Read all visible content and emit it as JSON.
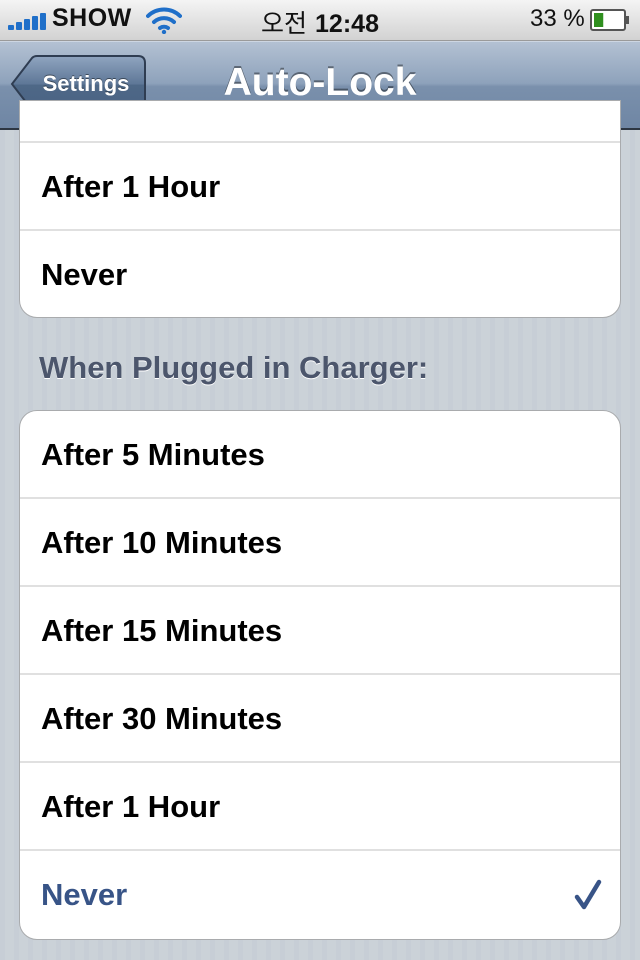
{
  "status_bar": {
    "carrier": "SHOW",
    "ampm": "오전",
    "time": "12:48",
    "battery_percent": "33 %",
    "battery_level": 0.33,
    "signal_bars": 5,
    "icons": [
      "signal-icon",
      "wifi-icon",
      "battery-icon"
    ]
  },
  "nav_bar": {
    "back_label": "Settings",
    "title": "Auto-Lock"
  },
  "section_1": {
    "rows": [
      {
        "label": ""
      },
      {
        "label": "After 1 Hour"
      },
      {
        "label": "Never"
      }
    ]
  },
  "section_2": {
    "header": "When Plugged in Charger:",
    "rows": [
      {
        "label": "After 5 Minutes"
      },
      {
        "label": "After 10 Minutes"
      },
      {
        "label": "After 15 Minutes"
      },
      {
        "label": "After 30 Minutes"
      },
      {
        "label": "After 1 Hour"
      },
      {
        "label": "Never",
        "selected": true
      }
    ]
  },
  "colors": {
    "selected_text": "#385487",
    "background": "#c5ccd4",
    "nav_bar": "#6f86a4"
  }
}
